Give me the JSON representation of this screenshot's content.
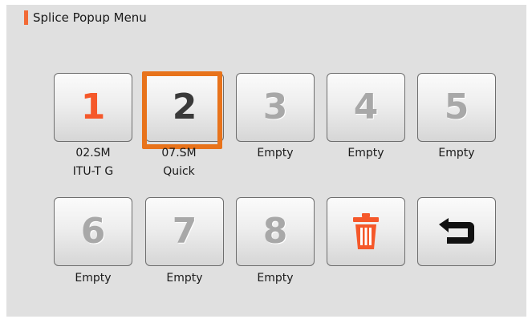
{
  "title": "Splice Popup Menu",
  "colors": {
    "accent": "#f26a36",
    "selection": "#e8731b",
    "trash": "#f5582a"
  },
  "slots": [
    {
      "number": "1",
      "line1": "02.SM",
      "line2": "ITU-T G"
    },
    {
      "number": "2",
      "line1": "07.SM",
      "line2": "Quick"
    },
    {
      "number": "3",
      "line1": "Empty",
      "line2": ""
    },
    {
      "number": "4",
      "line1": "Empty",
      "line2": ""
    },
    {
      "number": "5",
      "line1": "Empty",
      "line2": ""
    },
    {
      "number": "6",
      "line1": "Empty",
      "line2": ""
    },
    {
      "number": "7",
      "line1": "Empty",
      "line2": ""
    },
    {
      "number": "8",
      "line1": "Empty",
      "line2": ""
    }
  ],
  "selected_slot": "2",
  "actions": {
    "delete_icon": "trash-icon",
    "back_icon": "return-arrow-icon"
  }
}
